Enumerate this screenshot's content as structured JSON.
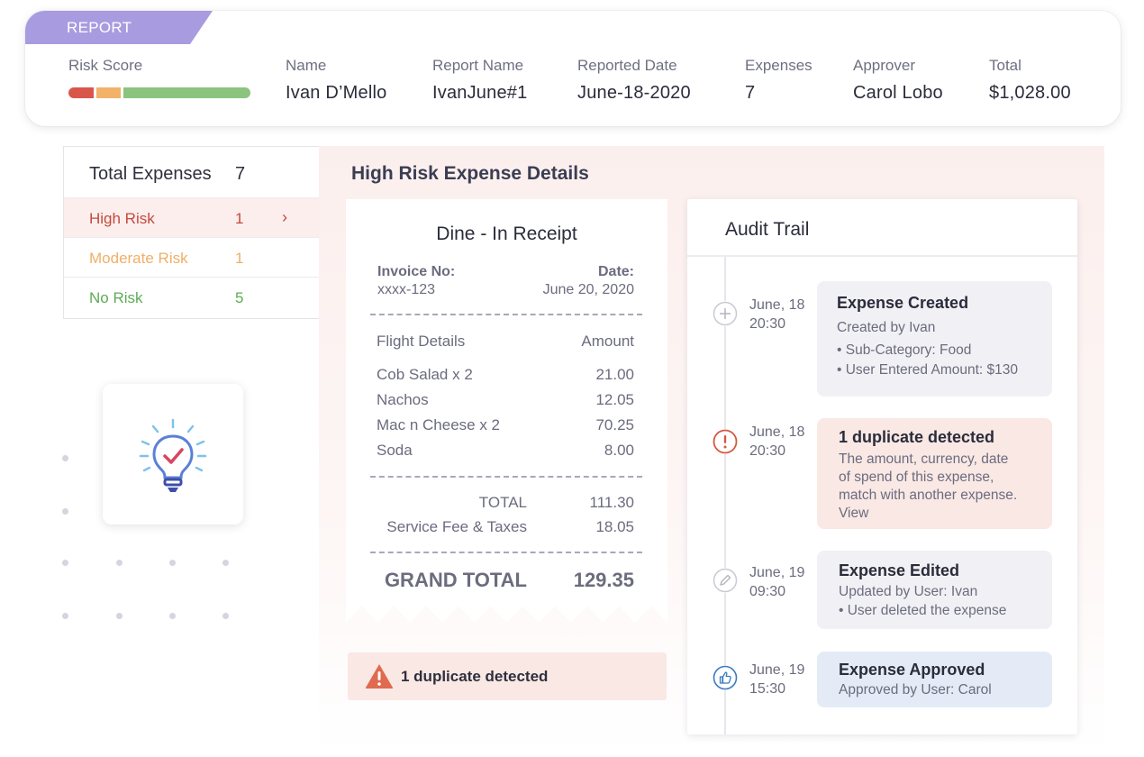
{
  "report": {
    "tag": "REPORT",
    "risk_score_label": "Risk Score",
    "risk_bar": {
      "high_color": "#d9574a",
      "moderate_color": "#f2b26a",
      "low_color": "#8cc37e"
    },
    "fields": [
      {
        "label": "Name",
        "value": "Ivan D’Mello"
      },
      {
        "label": "Report Name",
        "value": "IvanJune#1"
      },
      {
        "label": "Reported Date",
        "value": "June-18-2020"
      },
      {
        "label": "Expenses",
        "value": "7"
      },
      {
        "label": "Approver",
        "value": "Carol Lobo"
      },
      {
        "label": "Total",
        "value": "$1,028.00"
      }
    ]
  },
  "summary": {
    "header": {
      "label": "Total Expenses",
      "count": "7"
    },
    "rows": [
      {
        "label": "High Risk",
        "count": "1",
        "color": "#c44a3d"
      },
      {
        "label": "Moderate Risk",
        "count": "1",
        "color": "#eeb068"
      },
      {
        "label": "No Risk",
        "count": "5",
        "color": "#5dac55"
      }
    ],
    "selected_chevron": "›"
  },
  "illustration": {
    "icon": "lightbulb-check-icon"
  },
  "details": {
    "title": "High Risk Expense Details",
    "receipt": {
      "title": "Dine - In Receipt",
      "invoice_label": "Invoice No:",
      "invoice_value": "xxxx-123",
      "date_label": "Date:",
      "date_value": "June 20, 2020",
      "col_item": "Flight Details",
      "col_amount": "Amount",
      "items": [
        {
          "name": "Cob Salad x 2",
          "amount": "21.00"
        },
        {
          "name": "Nachos",
          "amount": "12.05"
        },
        {
          "name": "Mac n Cheese x 2",
          "amount": "70.25"
        },
        {
          "name": "Soda",
          "amount": "8.00"
        }
      ],
      "total_label": "TOTAL",
      "total_value": "111.30",
      "fee_label": "Service Fee & Taxes",
      "fee_value": "18.05",
      "grand_label": "GRAND TOTAL",
      "grand_value": "129.35"
    },
    "duplicate_warning": {
      "text": "1 duplicate detected",
      "icon": "warning-triangle-icon",
      "color": "#e06a4f"
    },
    "audit": {
      "title": "Audit Trail",
      "events": [
        {
          "date": "June, 18",
          "time": "20:30",
          "icon": "plus-circle-icon",
          "title": "Expense Created",
          "lines": [
            "Created by Ivan",
            "• Sub-Category: Food",
            "• User Entered Amount: $130"
          ]
        },
        {
          "date": "June, 18",
          "time": "20:30",
          "icon": "alert-circle-icon",
          "title": "1 duplicate detected",
          "lines": [
            "The amount, currency, date",
            "of spend of this expense,",
            "match with another expense."
          ],
          "link": "View"
        },
        {
          "date": "June, 19",
          "time": "09:30",
          "icon": "pencil-circle-icon",
          "title": "Expense Edited",
          "lines": [
            "Updated by User: Ivan",
            "• User deleted the expense"
          ]
        },
        {
          "date": "June, 19",
          "time": "15:30",
          "icon": "thumbs-up-circle-icon",
          "title": "Expense Approved",
          "lines": [
            "Approved by User: Carol"
          ]
        }
      ]
    }
  }
}
